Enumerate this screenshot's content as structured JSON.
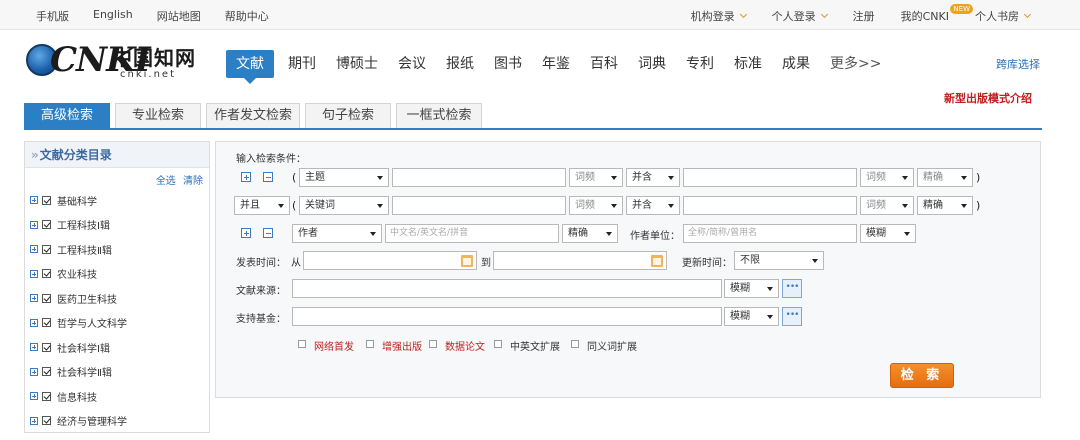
{
  "top": {
    "left": [
      "手机版",
      "English",
      "网站地图",
      "帮助中心"
    ],
    "right": [
      {
        "label": "机构登录",
        "chev": true
      },
      {
        "label": "个人登录",
        "chev": true
      },
      {
        "label": "注册",
        "chev": false
      },
      {
        "label": "我的CNKI",
        "chev": false,
        "badge": "NEW"
      },
      {
        "label": "个人书房",
        "chev": true
      }
    ]
  },
  "logo": {
    "brand": "CNKI",
    "cn": "中国知网",
    "domain": "cnki.net"
  },
  "nav": {
    "items": [
      "文献",
      "期刊",
      "博硕士",
      "会议",
      "报纸",
      "图书",
      "年鉴",
      "百科",
      "词典",
      "专利",
      "标准",
      "成果",
      "更多>>"
    ],
    "active": 0,
    "cross": "跨库选择"
  },
  "promo": "新型出版模式介绍",
  "tabs": {
    "items": [
      "高级检索",
      "专业检索",
      "作者发文检索",
      "句子检索",
      "一框式检索"
    ],
    "active": 0
  },
  "sidebar": {
    "title": "文献分类目录",
    "select_all": "全选",
    "clear": "清除",
    "items": [
      "基础科学",
      "工程科技Ⅰ辑",
      "工程科技Ⅱ辑",
      "农业科技",
      "医药卫生科技",
      "哲学与人文科学",
      "社会科学Ⅰ辑",
      "社会科学Ⅱ辑",
      "信息科技",
      "经济与管理科学"
    ]
  },
  "form": {
    "title": "输入检索条件：",
    "row1": {
      "field": "主题",
      "freq": "词频",
      "op": "并含",
      "freq2": "词频",
      "match": "精确"
    },
    "row2": {
      "logic": "并且",
      "field": "关键词",
      "freq": "词频",
      "op": "并含",
      "freq2": "词频",
      "match": "精确"
    },
    "row3": {
      "field": "作者",
      "placeholder": "中文名/英文名/拼音",
      "match": "精确",
      "unit_label": "作者单位：",
      "unit_placeholder": "全称/简称/曾用名",
      "unit_match": "模糊"
    },
    "date": {
      "label": "发表时间：",
      "from": "从",
      "to": "到",
      "update_label": "更新时间：",
      "update_value": "不限"
    },
    "source": {
      "label": "文献来源：",
      "match": "模糊",
      "dots": "•••"
    },
    "fund": {
      "label": "支持基金：",
      "match": "模糊",
      "dots": "•••"
    },
    "options": [
      "网络首发",
      "增强出版",
      "数据论文",
      "中英文扩展",
      "同义词扩展"
    ],
    "search_button": "检 索"
  }
}
